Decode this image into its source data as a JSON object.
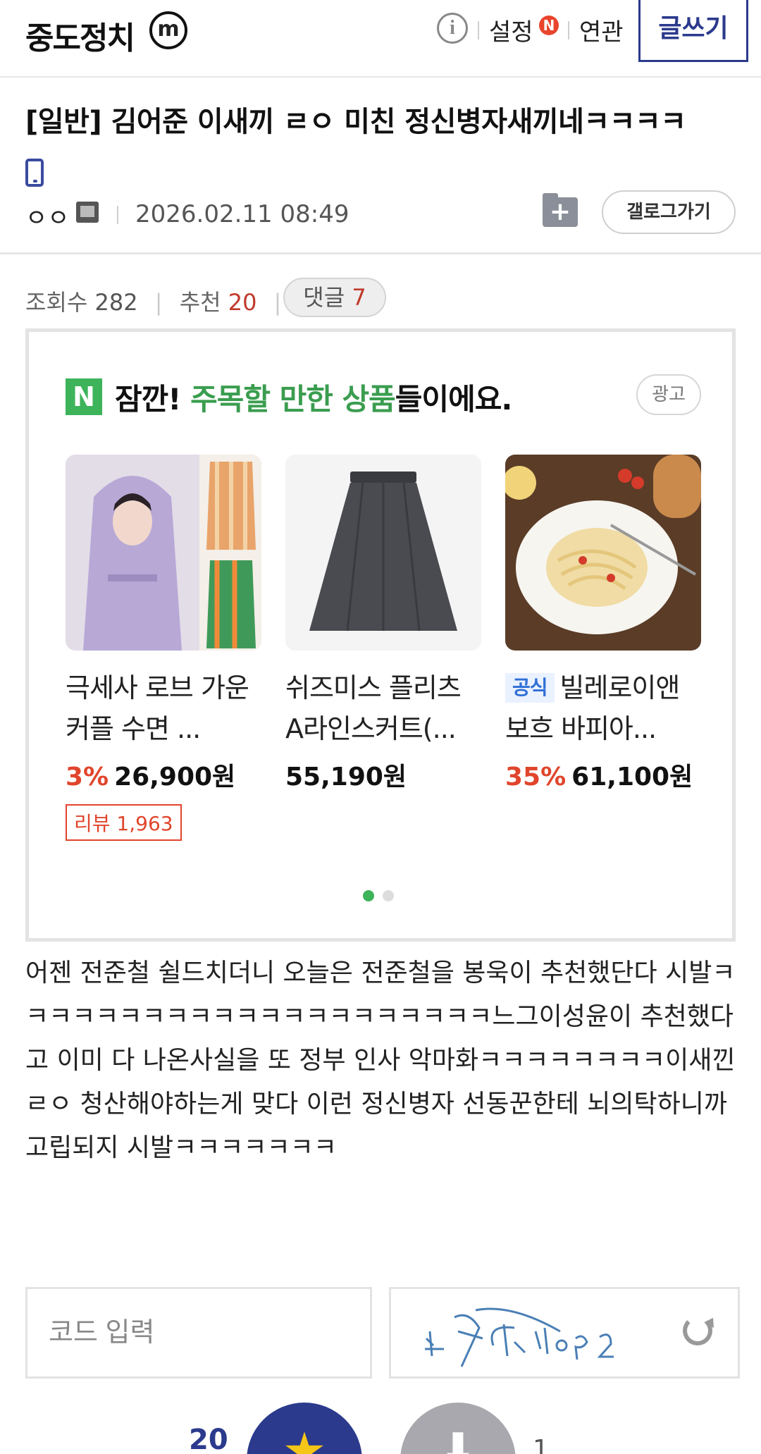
{
  "header": {
    "logo": "중도정치",
    "logo_badge": "m",
    "info_icon": "i",
    "settings_label": "설정",
    "settings_badge": "N",
    "related_label": "연관",
    "write_label": "글쓰기"
  },
  "post": {
    "title": "[일반] 김어준 이새끼 ㄹㅇ 미친 정신병자새끼네ㅋㅋㅋㅋ",
    "author": "ㅇㅇ",
    "date": "2026.02.11 08:49",
    "gallery_button": "갤로그가기",
    "views_label": "조회수",
    "views": "282",
    "recommend_label": "추천",
    "recommend": "20",
    "comments_label": "댓글",
    "comments": "7",
    "body": "어젠 전준철 쉴드치더니 오늘은 전준철을 봉욱이 추천했단다 시발ㅋㅋㅋㅋㅋㅋㅋㅋㅋㅋㅋㅋㅋㅋㅋㅋㅋㅋㅋㅋㅋ느그이성윤이 추천했다고 이미 다 나온사실을 또 정부 인사 악마화ㅋㅋㅋㅋㅋㅋㅋㅋ이새낀 ㄹㅇ 청산해야하는게 맞다 이런 정신병자 선동꾼한테 뇌의탁하니까 고립되지 시발ㅋㅋㅋㅋㅋㅋㅋ"
  },
  "ad": {
    "logo": "N",
    "title_pre": "잠깐! ",
    "title_green": "주목할 만한 상품",
    "title_post": "들이에요.",
    "badge": "광고",
    "products": [
      {
        "name": "극세사 로브 가운 커플 수면 ...",
        "discount": "3%",
        "price": "26,900원",
        "review": "리뷰 1,963",
        "official": ""
      },
      {
        "name": "쉬즈미스 플리츠 A라인스커트(...",
        "discount": "",
        "price": "55,190원",
        "review": "",
        "official": ""
      },
      {
        "name": "빌레로이앤보흐 바피아...",
        "discount": "35%",
        "price": "61,100원",
        "review": "",
        "official": "공식"
      }
    ],
    "page_count": 2,
    "active_page": 1
  },
  "captcha": {
    "placeholder": "코드 입력"
  },
  "votes": {
    "up": "20",
    "down": "1"
  },
  "colors": {
    "brand": "#2b3a8c",
    "accent_green": "#3a9d4f",
    "discount_red": "#e0452c"
  }
}
